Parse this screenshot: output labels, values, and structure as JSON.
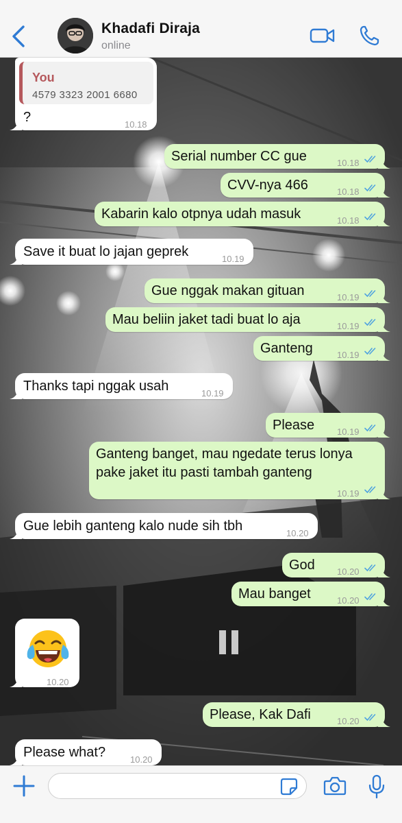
{
  "header": {
    "contact_name": "Khadafi Diraja",
    "status": "online",
    "icons": [
      "chevron-left-icon",
      "avatar",
      "video-camera-icon",
      "phone-icon"
    ]
  },
  "colors": {
    "accent": "#2f7bd4",
    "incoming_bubble": "#ffffff",
    "outgoing_bubble": "#dcf8c6",
    "read_ticks": "#4fa3e0",
    "reply_bar": "#b5585c"
  },
  "messages": [
    {
      "dir": "in",
      "reply_author": "You",
      "reply_text": "4579 3323 2001 6680",
      "text": "?",
      "time": "10.18"
    },
    {
      "dir": "out",
      "text": "Serial number CC gue",
      "time": "10.18",
      "read": true
    },
    {
      "dir": "out",
      "text": "CVV-nya 466",
      "time": "10.18",
      "read": true
    },
    {
      "dir": "out",
      "text": "Kabarin kalo otpnya udah masuk",
      "time": "10.18",
      "read": true
    },
    {
      "dir": "in",
      "text": "Save it buat lo jajan geprek",
      "time": "10.19"
    },
    {
      "dir": "out",
      "text": "Gue nggak makan gituan",
      "time": "10.19",
      "read": true
    },
    {
      "dir": "out",
      "text": "Mau beliin jaket tadi buat lo aja",
      "time": "10.19",
      "read": true
    },
    {
      "dir": "out",
      "text": "Ganteng",
      "time": "10.19",
      "read": true
    },
    {
      "dir": "in",
      "text": "Thanks tapi nggak usah",
      "time": "10.19"
    },
    {
      "dir": "out",
      "text": "Please",
      "time": "10.19",
      "read": true
    },
    {
      "dir": "out",
      "text_line1": "Ganteng banget, mau ngedate terus lonya",
      "text_line2": "pake jaket itu pasti tambah ganteng",
      "time": "10.19",
      "read": true
    },
    {
      "dir": "in",
      "text": "Gue lebih ganteng kalo nude sih tbh",
      "time": "10.20"
    },
    {
      "dir": "out",
      "text": "God",
      "time": "10.20",
      "read": true
    },
    {
      "dir": "out",
      "text": "Mau banget",
      "time": "10.20",
      "read": true
    },
    {
      "dir": "in",
      "emoji": "face-with-tears-of-joy",
      "time": "10.20"
    },
    {
      "dir": "out",
      "text": "Please, Kak Dafi",
      "time": "10.20",
      "read": true
    },
    {
      "dir": "in",
      "text": "Please what?",
      "time": "10.20"
    }
  ],
  "input": {
    "placeholder": "",
    "icons": [
      "plus-icon",
      "sticker-icon",
      "camera-icon",
      "microphone-icon"
    ]
  }
}
